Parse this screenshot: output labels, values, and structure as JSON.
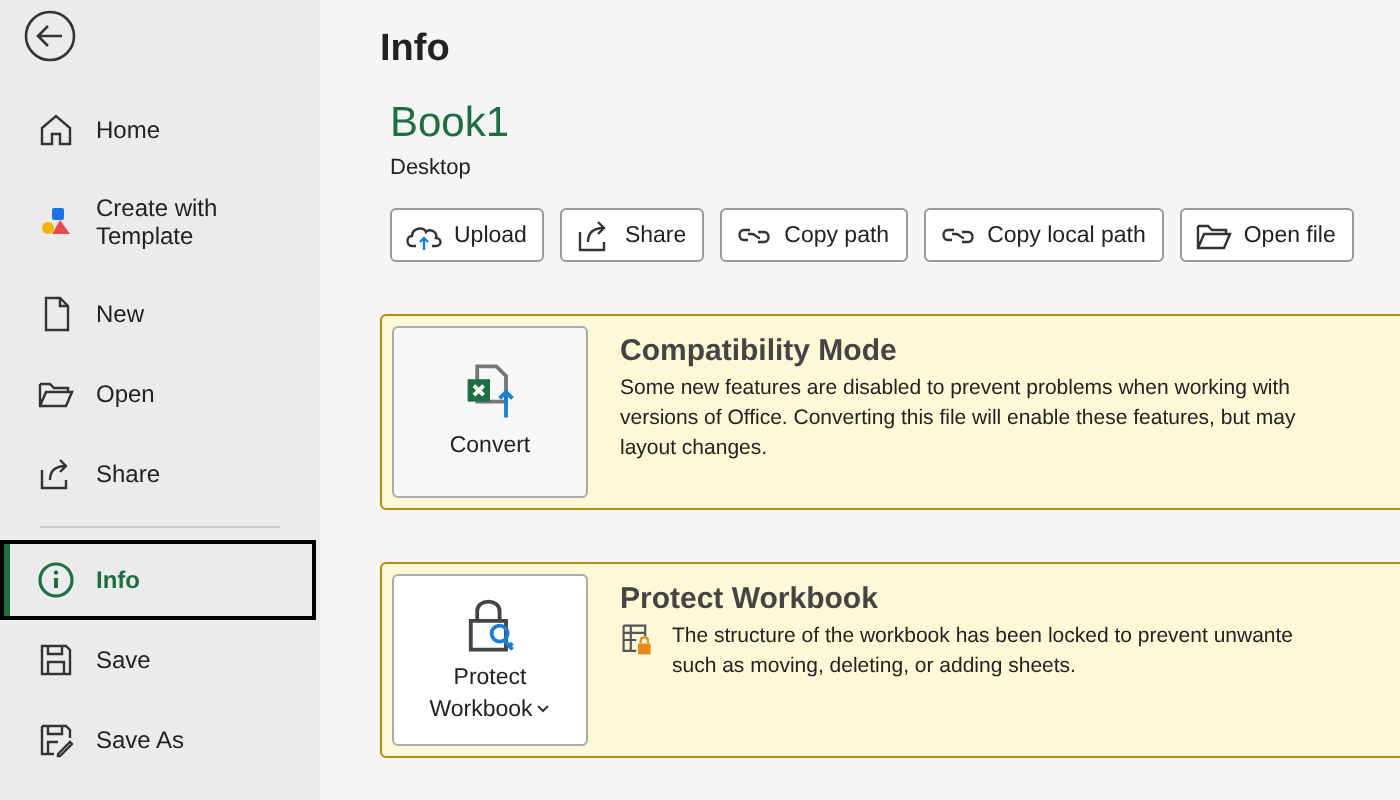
{
  "sidebar": {
    "items": [
      {
        "label": "Home",
        "selected": false
      },
      {
        "label": "Create with Template",
        "selected": false
      },
      {
        "label": "New",
        "selected": false
      },
      {
        "label": "Open",
        "selected": false
      },
      {
        "label": "Share",
        "selected": false
      },
      {
        "kind": "divider"
      },
      {
        "label": "Info",
        "selected": true
      },
      {
        "label": "Save",
        "selected": false
      },
      {
        "label": "Save As",
        "selected": false
      }
    ]
  },
  "page_title": "Info",
  "file": {
    "name": "Book1",
    "location": "Desktop"
  },
  "actions": [
    {
      "label": "Upload"
    },
    {
      "label": "Share"
    },
    {
      "label": "Copy path"
    },
    {
      "label": "Copy local path"
    },
    {
      "label": "Open file"
    }
  ],
  "cards": [
    {
      "kind": "convert",
      "button": [
        "Convert"
      ],
      "title": "Compatibility Mode",
      "description": [
        "Some new features are disabled to prevent problems when working with",
        "versions of Office. Converting this file will enable these features, but may",
        "layout changes."
      ]
    },
    {
      "kind": "protect",
      "button": [
        "Protect",
        "Workbook"
      ],
      "title": "Protect Workbook",
      "description": [
        "The structure of the workbook has been locked to prevent unwante",
        "such as moving, deleting, or adding sheets."
      ]
    }
  ]
}
